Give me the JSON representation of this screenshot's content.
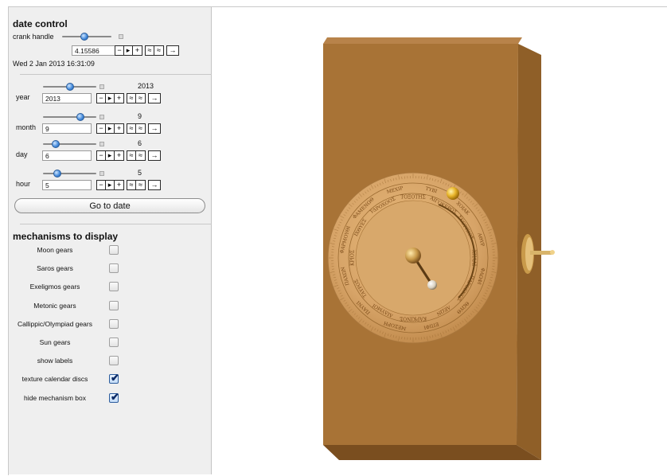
{
  "date_control": {
    "title": "date control",
    "crank_label": "crank handle",
    "crank_value": 0.45,
    "crank_input": "4.15586",
    "datetime": "Wed 2 Jan 2013 16:31:09"
  },
  "fields": [
    {
      "label": "year",
      "display": "2013",
      "input": "2013",
      "level": 0.5
    },
    {
      "label": "month",
      "display": "9",
      "input": "9",
      "level": 0.73
    },
    {
      "label": "day",
      "display": "6",
      "input": "6",
      "level": 0.2
    },
    {
      "label": "hour",
      "display": "5",
      "input": "5",
      "level": 0.22
    }
  ],
  "controls": {
    "minus": "−",
    "play": "▸",
    "plus": "+",
    "up": "≈",
    "down": "≈",
    "right": "→"
  },
  "goto_label": "Go to date",
  "mechanisms": {
    "title": "mechanisms to display",
    "items": [
      {
        "label": "Moon gears",
        "checked": false
      },
      {
        "label": "Saros gears",
        "checked": false
      },
      {
        "label": "Exeligmos gears",
        "checked": false
      },
      {
        "label": "Metonic gears",
        "checked": false
      },
      {
        "label": "Callippic/Olympiad gears",
        "checked": false
      },
      {
        "label": "Sun gears",
        "checked": false
      },
      {
        "label": "show labels",
        "checked": false
      },
      {
        "label": "texture calendar discs",
        "checked": true
      },
      {
        "label": "hide mechanism box",
        "checked": true
      }
    ]
  },
  "dial_labels": {
    "outer": [
      "ΜΕΧΙΡ",
      "ΤΥΒΙ",
      "ΧΟΙΑΚ",
      "ΑΘΥΡ",
      "ΦΑΩΦΙ",
      "ΘΩΥΘ",
      "ΕΠΙΦΙ",
      "ΜΕΣΟΡΗ",
      "ΠΑΥΝΙ",
      "ΠΑΧΩΝ",
      "ΦΑΡΜΟΥΘΙ",
      "ΦΑΜΕΝΩΘ"
    ],
    "inner": [
      "ΤΟΞΟΤΗΣ",
      "ΑΙΓΟΚΕΡΩΣ",
      "ΣΚΟΡΠΙΟΣ",
      "ΧΗΛΑΙ",
      "ΠΑΡΘΕΝΟΣ",
      "ΛΕΩΝ",
      "ΚΑΡΚΙΝΟΣ",
      "ΔΙΔΥΜΟΙ",
      "ΤΑΥΡΟΣ",
      "ΚΡΙΟΣ",
      "ΙΧΘΥΕΣ",
      "ΥΔΡΟΧΟΟΣ"
    ]
  },
  "colors": {
    "box_front": "#a87336",
    "box_side": "#8f5f28",
    "box_top": "#b8834a",
    "dial": "#d7a468",
    "slider_thumb": "#3f86d9"
  }
}
